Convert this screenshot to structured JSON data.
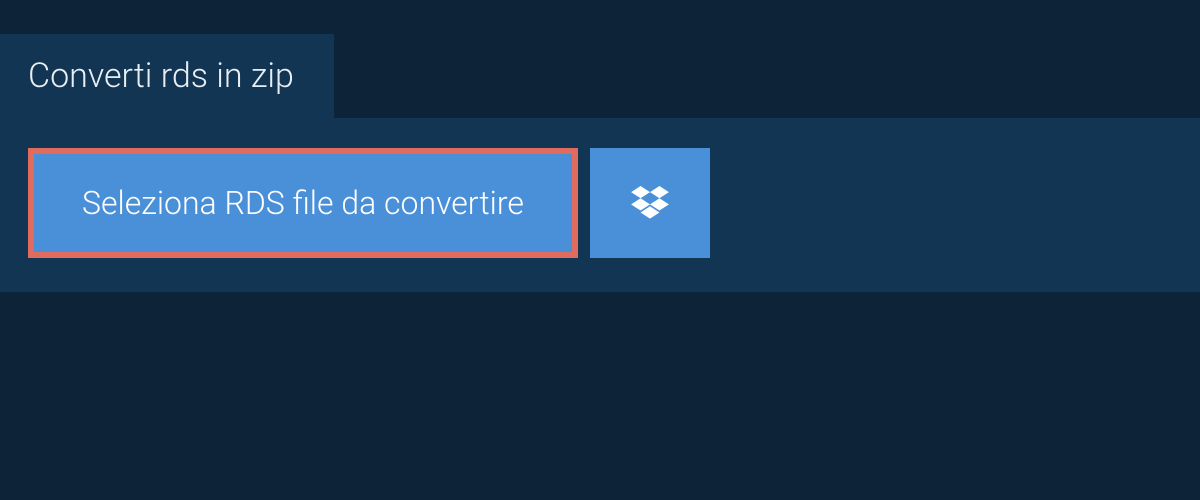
{
  "tab": {
    "label": "Converti rds in zip"
  },
  "panel": {
    "select_button_label": "Seleziona RDS file da convertire"
  },
  "colors": {
    "background": "#0d2438",
    "panel": "#113552",
    "button": "#4a90d9",
    "highlight_border": "#e06b5f",
    "text_light": "#e8eef3",
    "text_white": "#ffffff"
  }
}
